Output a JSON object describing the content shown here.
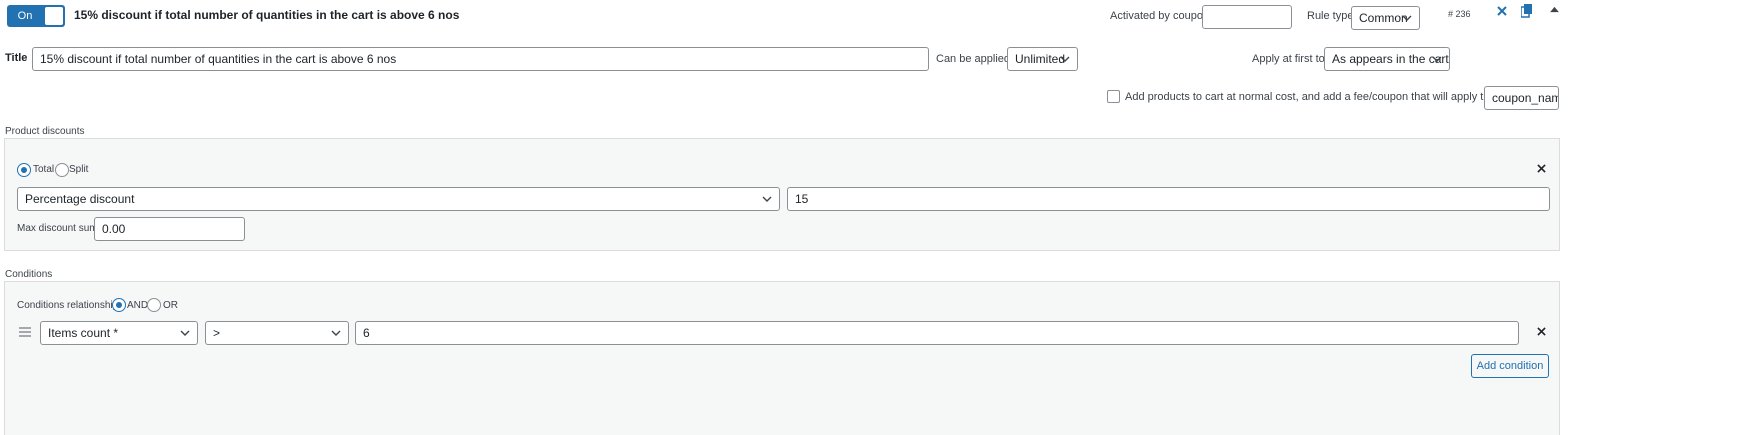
{
  "header": {
    "toggle_label": "On",
    "rule_name": "15% discount if total number of quantities in the cart is above 6 nos",
    "activated_by_coupon_label": "Activated by coupon",
    "activated_by_coupon_value": "",
    "rule_type_label": "Rule type",
    "rule_type_value": "Common",
    "rule_id": "# 236"
  },
  "title_row": {
    "title_label": "Title",
    "title_value": "15% discount if total number of quantities in the cart is above 6 nos",
    "can_be_applied_label": "Can be applied:",
    "can_be_applied_value": "Unlimited",
    "apply_first_label": "Apply at first to:",
    "apply_first_value": "As appears in the cart"
  },
  "cost_row": {
    "checkbox_label": "Add products to cart at normal cost, and add a fee/coupon that will apply that cost",
    "checked": false,
    "coupon_value": "coupon_name"
  },
  "product_discounts": {
    "section_label": "Product discounts",
    "mode_options": [
      "Total",
      "Split"
    ],
    "mode_selected": "Total",
    "discount_type": "Percentage discount",
    "discount_value": "15",
    "max_discount_label": "Max discount sum:",
    "max_discount_value": "0.00"
  },
  "conditions": {
    "section_label": "Conditions",
    "relationship_label": "Conditions relationship",
    "relationship_options": [
      "AND",
      "OR"
    ],
    "relationship_selected": "AND",
    "rows": [
      {
        "field": "Items count *",
        "operator": ">",
        "value": "6"
      }
    ],
    "add_button": "Add condition"
  },
  "colors": {
    "accent": "#2271b1",
    "panel_bg": "#f6f7f7",
    "border": "#8c8f94"
  },
  "icons": [
    "close-icon",
    "copy-icon",
    "collapse-icon",
    "drag-handle-icon",
    "chevron-down-icon"
  ]
}
